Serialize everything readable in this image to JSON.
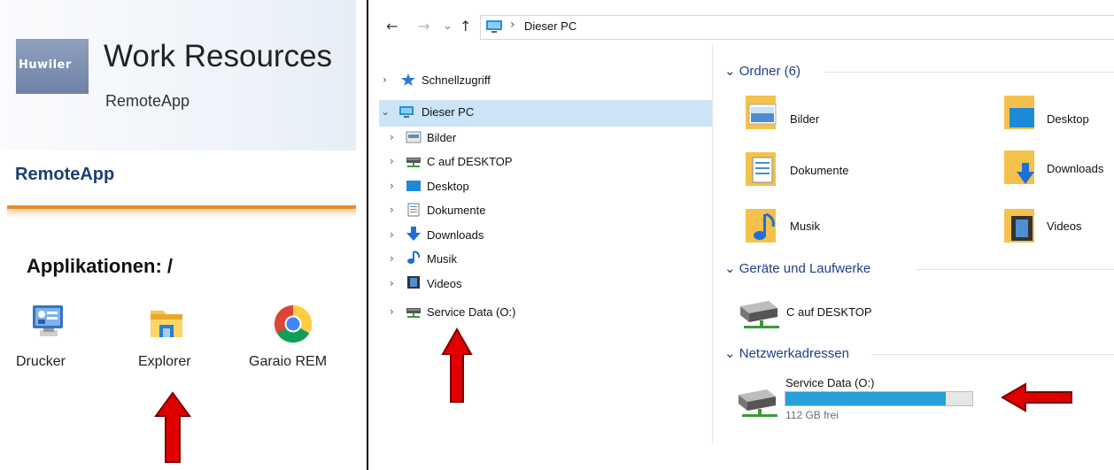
{
  "remote_portal": {
    "logo_text": "Huwiler",
    "title": "Work Resources",
    "subtitle": "RemoteApp",
    "section_heading": "RemoteApp",
    "apps_heading": "Applikationen: /",
    "apps": [
      {
        "label": "Drucker",
        "icon": "printer-control-icon"
      },
      {
        "label": "Explorer",
        "icon": "folder-explorer-icon"
      },
      {
        "label": "Garaio REM",
        "icon": "chrome-icon"
      }
    ]
  },
  "explorer": {
    "toolbar": {
      "back": "←",
      "forward": "→",
      "recent": "⌄",
      "up": "↑"
    },
    "address": {
      "separator": "›",
      "location": "Dieser PC"
    },
    "nav_tree": [
      {
        "label": "Schnellzugriff",
        "icon": "star-icon"
      },
      {
        "label": "Dieser PC",
        "icon": "computer-icon",
        "expanded": true,
        "selected": true
      },
      {
        "label": "Bilder",
        "icon": "pictures-icon"
      },
      {
        "label": "C auf DESKTOP",
        "icon": "network-drive-icon"
      },
      {
        "label": "Desktop",
        "icon": "desktop-icon"
      },
      {
        "label": "Dokumente",
        "icon": "documents-icon"
      },
      {
        "label": "Downloads",
        "icon": "downloads-icon"
      },
      {
        "label": "Musik",
        "icon": "music-icon"
      },
      {
        "label": "Videos",
        "icon": "videos-icon"
      },
      {
        "label": "Service Data (O:)",
        "icon": "network-drive-icon"
      }
    ],
    "groups": {
      "folders": "Ordner (6)",
      "devices": "Geräte und Laufwerke",
      "network": "Netzwerkadressen"
    },
    "folders": [
      {
        "label": "Bilder"
      },
      {
        "label": "Desktop"
      },
      {
        "label": "Dokumente"
      },
      {
        "label": "Downloads"
      },
      {
        "label": "Musik"
      },
      {
        "label": "Videos"
      }
    ],
    "devices": [
      {
        "label": "C auf DESKTOP"
      }
    ],
    "network": [
      {
        "label": "Service Data (O:)",
        "free": "112 GB frei",
        "used_fraction": 0.86
      }
    ]
  },
  "colors": {
    "accent_orange": "#f08a2b",
    "heading_blue": "#1a3f73",
    "selection": "#cce4f7",
    "drive_fill": "#26a0da",
    "arrow_red": "#e00000"
  }
}
